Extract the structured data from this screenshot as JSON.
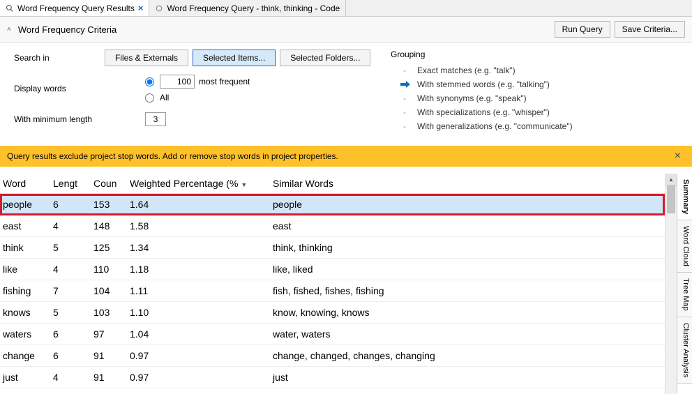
{
  "tabs": {
    "active": {
      "label": "Word Frequency Query Results"
    },
    "inactive": {
      "label": "Word Frequency Query - think, thinking - Code"
    }
  },
  "header": {
    "title": "Word Frequency Criteria",
    "run_button": "Run Query",
    "save_button": "Save Criteria..."
  },
  "criteria": {
    "search_in_label": "Search in",
    "buttons": {
      "files": "Files & Externals",
      "selected_items": "Selected Items...",
      "selected_folders": "Selected Folders..."
    },
    "display_words_label": "Display words",
    "display_count": "100",
    "most_frequent_label": "most frequent",
    "all_label": "All",
    "min_length_label": "With minimum length",
    "min_length_value": "3"
  },
  "grouping": {
    "title": "Grouping",
    "options": [
      "Exact matches (e.g. \"talk\")",
      "With stemmed words (e.g. \"talking\")",
      "With synonyms (e.g. \"speak\")",
      "With specializations (e.g. \"whisper\")",
      "With generalizations (e.g. \"communicate\")"
    ],
    "selected_index": 1
  },
  "notice": {
    "text": "Query results exclude project stop words. Add or remove stop words in project properties."
  },
  "columns": {
    "word": "Word",
    "length": "Lengt",
    "count": "Coun",
    "weighted": "Weighted Percentage (%",
    "similar": "Similar Words"
  },
  "rows": [
    {
      "word": "people",
      "length": "6",
      "count": "153",
      "pct": "1.64",
      "similar": "people",
      "hl": true
    },
    {
      "word": "east",
      "length": "4",
      "count": "148",
      "pct": "1.58",
      "similar": "east"
    },
    {
      "word": "think",
      "length": "5",
      "count": "125",
      "pct": "1.34",
      "similar": "think, thinking"
    },
    {
      "word": "like",
      "length": "4",
      "count": "110",
      "pct": "1.18",
      "similar": "like, liked"
    },
    {
      "word": "fishing",
      "length": "7",
      "count": "104",
      "pct": "1.11",
      "similar": "fish, fished, fishes, fishing"
    },
    {
      "word": "knows",
      "length": "5",
      "count": "103",
      "pct": "1.10",
      "similar": "know, knowing, knows"
    },
    {
      "word": "waters",
      "length": "6",
      "count": "97",
      "pct": "1.04",
      "similar": "water, waters"
    },
    {
      "word": "change",
      "length": "6",
      "count": "91",
      "pct": "0.97",
      "similar": "change, changed, changes, changing"
    },
    {
      "word": "just",
      "length": "4",
      "count": "91",
      "pct": "0.97",
      "similar": "just"
    }
  ],
  "sidetabs": {
    "summary": "Summary",
    "wordcloud": "Word Cloud",
    "treemap": "Tree Map",
    "cluster": "Cluster Analysis"
  }
}
